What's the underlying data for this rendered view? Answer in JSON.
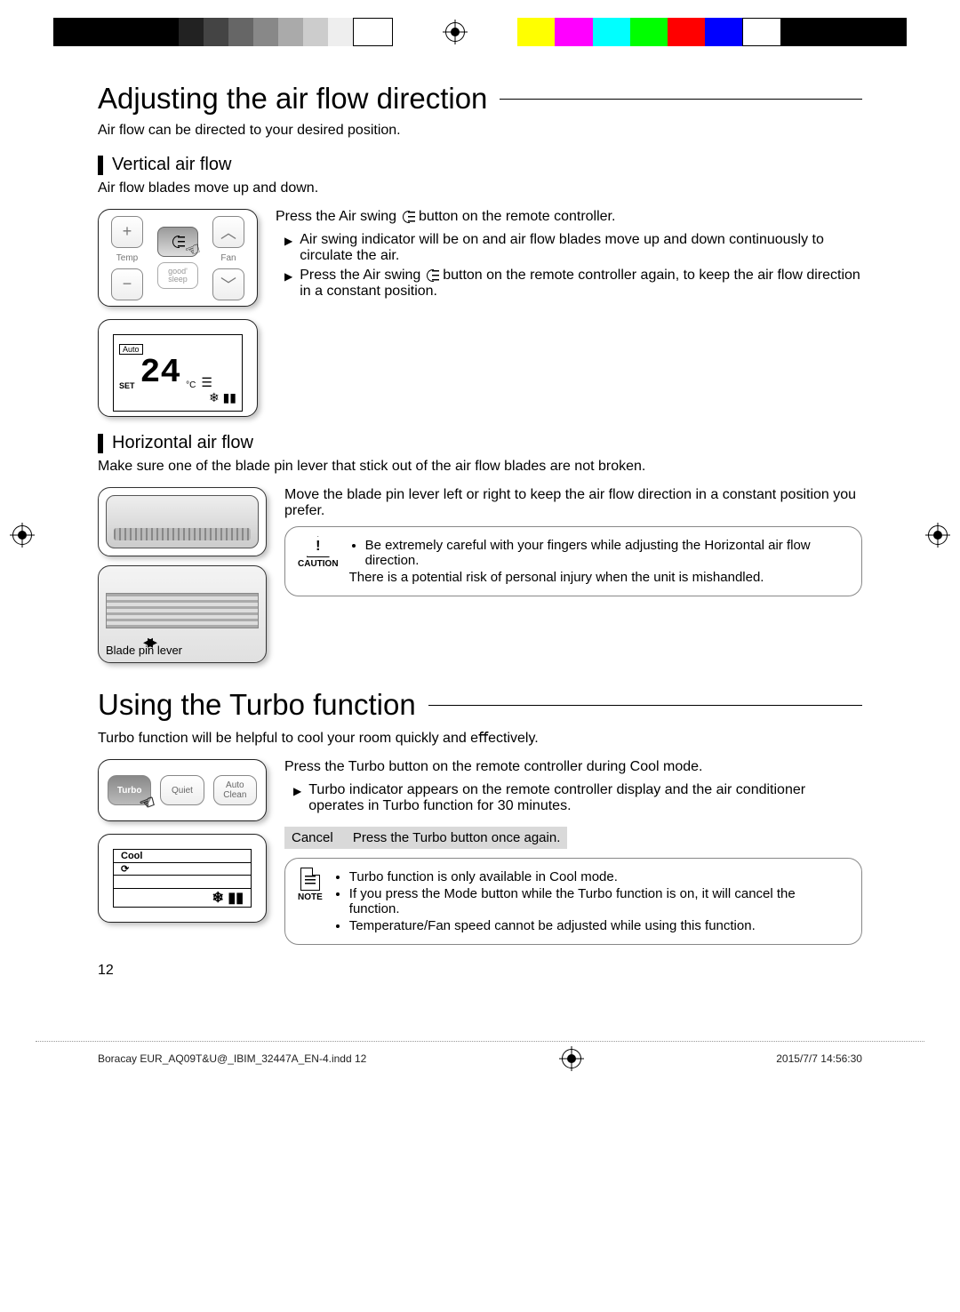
{
  "section1": {
    "title": "Adjusting the air ﬂow direction",
    "intro": "Air ﬂow can be directed to your desired position.",
    "sub1": {
      "title": "Vertical air ﬂow",
      "desc": "Air ﬂow blades move up and down.",
      "lead_a": "Press the Air swing",
      "lead_b": "button on the remote controller.",
      "b1": "Air swing indicator will be on and air ﬂow blades move up and down continuously to circulate the air.",
      "b2a": "Press the Air swing",
      "b2b": "button on the remote controller again, to keep the air ﬂow direction in a constant position."
    },
    "sub2": {
      "title": "Horizontal air ﬂow",
      "desc": "Make sure one of the blade pin lever that stick out of the air ﬂow blades are not broken.",
      "lead": "Move the blade pin lever left or right to keep the air ﬂow direction in a constant position you prefer.",
      "pin_label": "Blade pin lever",
      "caution_label": "CAUTION",
      "caution1": "Be extremely careful with your ﬁngers while adjusting the Horizontal air ﬂow direction.",
      "caution2": "There is a potential risk of personal injury when the unit is mishandled."
    },
    "remote": {
      "temp_label": "Temp",
      "fan_label": "Fan",
      "good_sleep": "good' sleep",
      "lcd_auto": "Auto",
      "lcd_set": "SET",
      "lcd_temp": "24",
      "lcd_unit": "°C"
    }
  },
  "section2": {
    "title": "Using the Turbo function",
    "intro": "Turbo function will be helpful to cool your room quickly and eﬀectively.",
    "lead": "Press the Turbo button on the remote controller during Cool mode.",
    "b1": "Turbo indicator appears on the remote controller display and the air conditioner operates in Turbo function for 30 minutes.",
    "cancel_label": "Cancel",
    "cancel_text": "Press the Turbo button once again.",
    "note_label": "NOTE",
    "n1": "Turbo function is only available in Cool mode.",
    "n2": "If you press the Mode button while the Turbo function is on, it will cancel the function.",
    "n3": "Temperature/Fan speed cannot be adjusted while using this function.",
    "remote": {
      "turbo": "Turbo",
      "quiet": "Quiet",
      "auto_clean": "Auto Clean",
      "lcd_cool": "Cool"
    }
  },
  "page_number": "12",
  "footer": {
    "file": "Boracay EUR_AQ09T&U@_IBIM_32447A_EN-4.indd   12",
    "date": "2015/7/7   14:56:30"
  },
  "print_bar_colors": [
    "#000",
    "#222",
    "#444",
    "#666",
    "#888",
    "#aaa",
    "#ccc",
    "#eee",
    "#fff",
    "#fff",
    "#fff",
    "#ff0",
    "#f0f",
    "#0ff",
    "#0f0",
    "#f00",
    "#00f",
    "#fff",
    "#000",
    "#000"
  ]
}
